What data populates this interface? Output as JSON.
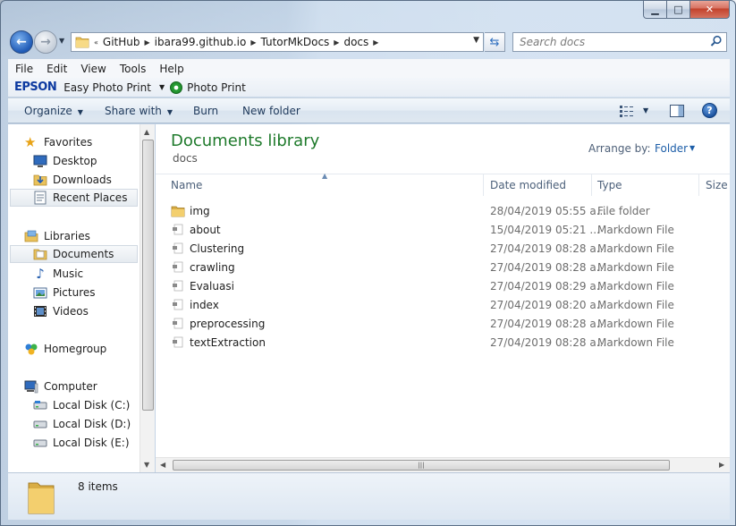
{
  "window": {
    "buttons": {
      "minimize": "▁",
      "maximize": "□",
      "close": "✕"
    }
  },
  "address": {
    "overflow": "«",
    "crumbs": [
      "GitHub",
      "ibara99.github.io",
      "TutorMkDocs",
      "docs"
    ],
    "search_placeholder": "Search docs"
  },
  "menubar": [
    "File",
    "Edit",
    "View",
    "Tools",
    "Help"
  ],
  "epson_bar": {
    "logo": "EPSON",
    "easy_photo_print": "Easy Photo Print",
    "photo_print": "Photo Print"
  },
  "commandbar": {
    "organize": "Organize",
    "share_with": "Share with",
    "burn": "Burn",
    "new_folder": "New folder"
  },
  "navpane": {
    "favorites": "Favorites",
    "desktop": "Desktop",
    "downloads": "Downloads",
    "recent_places": "Recent Places",
    "libraries": "Libraries",
    "documents": "Documents",
    "music": "Music",
    "pictures": "Pictures",
    "videos": "Videos",
    "homegroup": "Homegroup",
    "computer": "Computer",
    "disk_c": "Local Disk (C:)",
    "disk_d": "Local Disk (D:)",
    "disk_e": "Local Disk (E:)"
  },
  "library": {
    "title": "Documents library",
    "subtitle": "docs",
    "arrange_by_label": "Arrange by:",
    "arrange_by_value": "Folder"
  },
  "columns": {
    "name": "Name",
    "date": "Date modified",
    "type": "Type",
    "size": "Size"
  },
  "files": [
    {
      "name": "img",
      "date": "28/04/2019 05:55 a...",
      "type": "File folder",
      "icon": "folder-icon"
    },
    {
      "name": "about",
      "date": "15/04/2019 05:21 ...",
      "type": "Markdown File",
      "icon": "markdown-file-icon"
    },
    {
      "name": "Clustering",
      "date": "27/04/2019 08:28 a...",
      "type": "Markdown File",
      "icon": "markdown-file-icon"
    },
    {
      "name": "crawling",
      "date": "27/04/2019 08:28 a...",
      "type": "Markdown File",
      "icon": "markdown-file-icon"
    },
    {
      "name": "Evaluasi",
      "date": "27/04/2019 08:29 a...",
      "type": "Markdown File",
      "icon": "markdown-file-icon"
    },
    {
      "name": "index",
      "date": "27/04/2019 08:20 a...",
      "type": "Markdown File",
      "icon": "markdown-file-icon"
    },
    {
      "name": "preprocessing",
      "date": "27/04/2019 08:28 a...",
      "type": "Markdown File",
      "icon": "markdown-file-icon"
    },
    {
      "name": "textExtraction",
      "date": "27/04/2019 08:28 a...",
      "type": "Markdown File",
      "icon": "markdown-file-icon"
    }
  ],
  "details_pane": {
    "item_count": "8 items"
  }
}
